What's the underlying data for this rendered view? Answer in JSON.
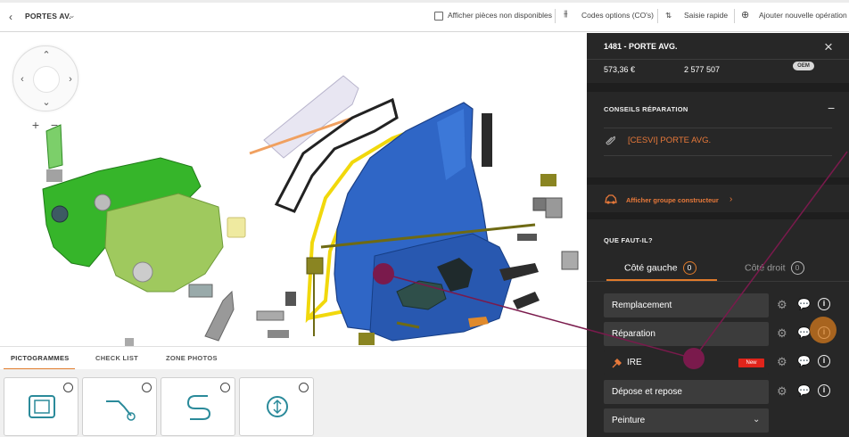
{
  "topbar": {
    "back_icon": "chevron-left-icon",
    "breadcrumb": "PORTES AV.",
    "show_unavailable": "Afficher pièces non disponibles",
    "option_codes": "Codes options (CO's)",
    "quick_entry": "Saisie rapide",
    "add_operation": "Ajouter nouvelle opération"
  },
  "bottom_tabs": [
    "PICTOGRAMMES",
    "CHECK LIST",
    "ZONE PHOTOS"
  ],
  "pictograms": [
    "windscreen-icon",
    "tool-icon",
    "wiring-icon",
    "airbag-icon"
  ],
  "panel": {
    "title": "1481 - PORTE AVG.",
    "price": "573,36 €",
    "reference": "2 577 507",
    "oem_badge": "OEM",
    "repair_tips_heading": "CONSEILS RÉPARATION",
    "repair_tip": "[CESVI] PORTE AVG.",
    "manufacturer_group_link": "Afficher groupe constructeur",
    "what_to_do_heading": "QUE FAUT-IL?",
    "side_tabs": [
      {
        "label": "Côté gauche",
        "count": "0"
      },
      {
        "label": "Côté droit",
        "count": "0"
      }
    ],
    "operations": [
      {
        "label": "Remplacement"
      },
      {
        "label": "Réparation"
      },
      {
        "label": "IRE",
        "badge": "New"
      },
      {
        "label": "Dépose et repose"
      },
      {
        "label": "Peinture"
      }
    ]
  },
  "colors": {
    "accent": "#e07b2b",
    "panel_bg": "#272727",
    "annotation": "#7a1a4c",
    "new_badge": "#e0241b"
  }
}
